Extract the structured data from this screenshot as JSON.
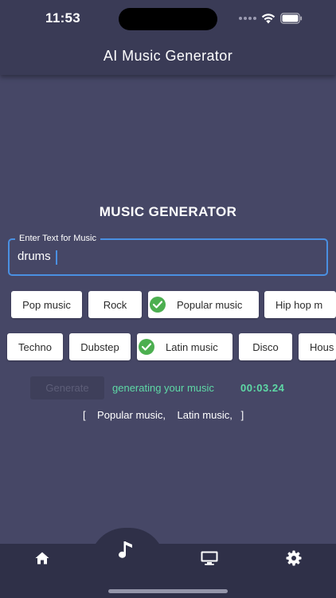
{
  "status_bar": {
    "time": "11:53"
  },
  "header": {
    "title": "AI Music Generator"
  },
  "main": {
    "section_title": "MUSIC GENERATOR",
    "text_field": {
      "label": "Enter Text for Music",
      "value": "drums"
    },
    "genre_rows": [
      [
        {
          "label": "Pop music",
          "selected": false
        },
        {
          "label": "Rock",
          "selected": false
        },
        {
          "label": "Popular music",
          "selected": true
        },
        {
          "label": "Hip hop m",
          "selected": false
        }
      ],
      [
        {
          "label": "Techno",
          "selected": false
        },
        {
          "label": "Dubstep",
          "selected": false
        },
        {
          "label": "Latin music",
          "selected": true
        },
        {
          "label": "Disco",
          "selected": false
        },
        {
          "label": "Hous",
          "selected": false
        }
      ]
    ],
    "generate_button": {
      "label": "Generate",
      "enabled": false
    },
    "generation_status": "generating your music",
    "generation_timer": "00:03.24",
    "selected_genres_text": "[    Popular music,    Latin music,   ]"
  },
  "bottom_nav": {
    "items": [
      {
        "id": "home",
        "icon": "home-icon",
        "active": false
      },
      {
        "id": "music",
        "icon": "music-note-icon",
        "active": true
      },
      {
        "id": "desktop",
        "icon": "desktop-icon",
        "active": false
      },
      {
        "id": "settings",
        "icon": "gear-icon",
        "active": false
      }
    ]
  },
  "colors": {
    "background": "#464766",
    "header": "#3a3b56",
    "navbar": "#2f3048",
    "accent_green": "#5ed9a6",
    "field_border": "#4a90e2",
    "check_green": "#4caf50"
  }
}
